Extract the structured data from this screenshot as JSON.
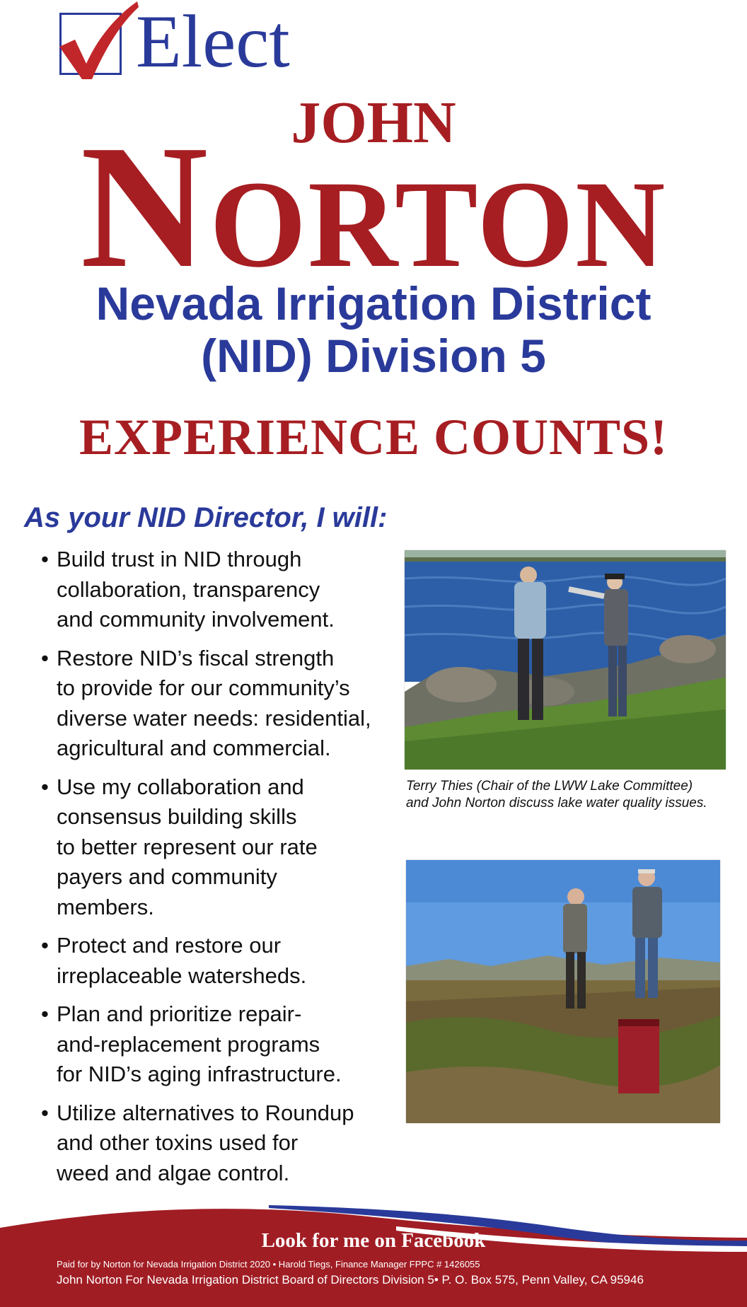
{
  "header": {
    "elect": "Elect",
    "first_name": "JOHN",
    "last_name_initial": "N",
    "last_name_rest": "ORTON",
    "district_line1": "Nevada Irrigation District",
    "district_line2": "(NID) Division 5",
    "slogan": "EXPERIENCE COUNTS!"
  },
  "platform": {
    "intro": "As your NID Director, I will:",
    "items": [
      {
        "lines": [
          "Build trust in NID through",
          "collaboration, transparency",
          "and community involvement."
        ]
      },
      {
        "lines": [
          "Restore NID’s fiscal strength",
          "to provide for our community’s",
          "diverse water needs: residential,",
          "agricultural and commercial."
        ]
      },
      {
        "lines": [
          "Use my collaboration and",
          "consensus building skills",
          "to better represent our rate",
          "payers and community",
          "members."
        ]
      },
      {
        "lines": [
          "Protect and restore our",
          "irreplaceable watersheds."
        ]
      },
      {
        "lines": [
          "Plan and prioritize repair-",
          "and-replacement programs",
          "for NID’s aging infrastructure."
        ]
      },
      {
        "lines": [
          "Utilize alternatives to Roundup",
          "and other toxins used for",
          "weed and algae control."
        ]
      }
    ]
  },
  "photos": {
    "caption1": "Terry Thies (Chair of the LWW Lake Committee) and John Norton discuss lake water quality issues."
  },
  "footer": {
    "facebook": "Look for me on Facebook",
    "paid_for": "Paid for by Norton for Nevada Irrigation District 2020  •  Harold Tiegs, Finance Manager  FPPC # 1426055",
    "address": "John Norton For Nevada Irrigation District Board of Directors Division 5• P. O. Box 575, Penn Valley, CA 95946"
  },
  "colors": {
    "blue": "#2a3a9a",
    "red": "#a61e22"
  }
}
